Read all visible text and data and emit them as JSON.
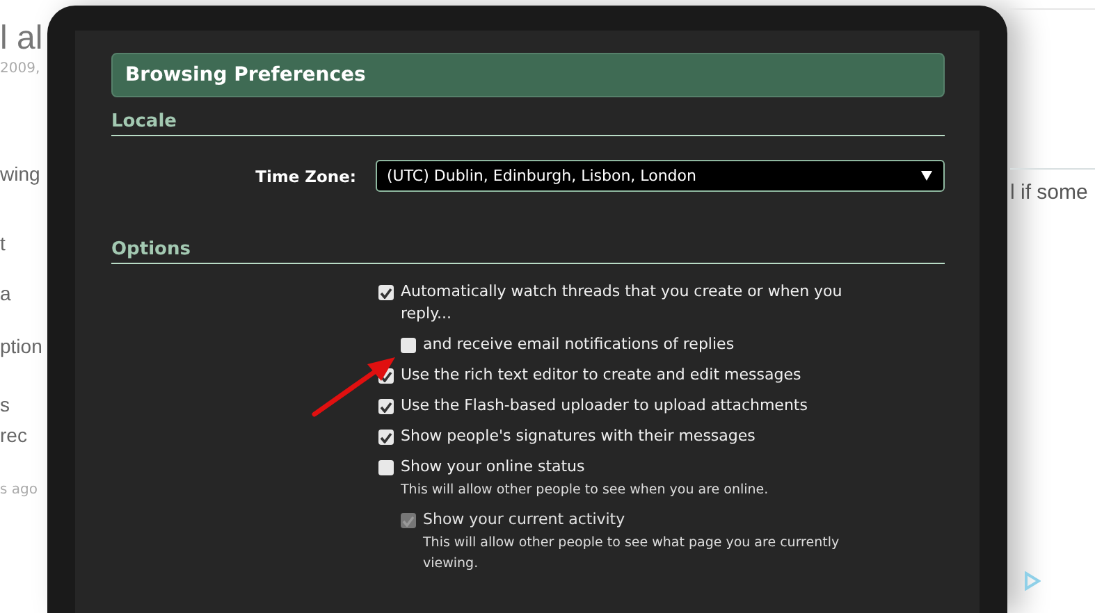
{
  "background_page": {
    "title_fragment": "l al",
    "meta_fragment": "2009,",
    "body_fragments": [
      "wing",
      "t",
      "a",
      "ption",
      "s",
      "rec"
    ],
    "footer_fragment": "s ago",
    "right_fragment": "l if some"
  },
  "dialog": {
    "header": "Browsing Preferences",
    "locale": {
      "title": "Locale",
      "time_zone": {
        "label": "Time Zone:",
        "value": "(UTC) Dublin, Edinburgh, Lisbon, London"
      }
    },
    "options": {
      "title": "Options",
      "items": [
        {
          "label": "Automatically watch threads that you create or when you reply...",
          "checked": true,
          "disabled": false,
          "children": [
            {
              "label": "and receive email notifications of replies",
              "checked": false,
              "disabled": false
            }
          ]
        },
        {
          "label": "Use the rich text editor to create and edit messages",
          "checked": true,
          "disabled": false
        },
        {
          "label": "Use the Flash-based uploader to upload attachments",
          "checked": true,
          "disabled": false
        },
        {
          "label": "Show people's signatures with their messages",
          "checked": true,
          "disabled": false
        },
        {
          "label": "Show your online status",
          "checked": false,
          "disabled": false,
          "hint": "This will allow other people to see when you are online.",
          "children": [
            {
              "label": "Show your current activity",
              "checked": true,
              "disabled": true,
              "hint": "This will allow other people to see what page you are currently viewing."
            }
          ]
        }
      ]
    }
  }
}
